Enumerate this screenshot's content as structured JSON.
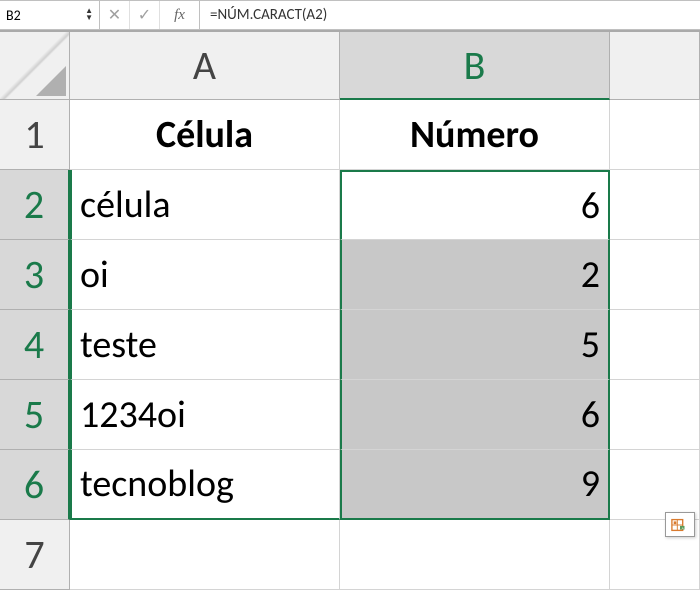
{
  "name_box": "B2",
  "formula": "=NÚM.CARACT(A2)",
  "columns": [
    "A",
    "B"
  ],
  "row_numbers": [
    "1",
    "2",
    "3",
    "4",
    "5",
    "6",
    "7"
  ],
  "headers": {
    "A": "Célula",
    "B": "Número"
  },
  "rows": [
    {
      "a": "célula",
      "b": "6"
    },
    {
      "a": "oi",
      "b": "2"
    },
    {
      "a": "teste",
      "b": "5"
    },
    {
      "a": "1234oi",
      "b": "6"
    },
    {
      "a": "tecnoblog",
      "b": "9"
    }
  ],
  "chart_data": {
    "type": "table",
    "title": "",
    "columns": [
      "Célula",
      "Número"
    ],
    "data": [
      [
        "célula",
        6
      ],
      [
        "oi",
        2
      ],
      [
        "teste",
        5
      ],
      [
        "1234oi",
        6
      ],
      [
        "tecnoblog",
        9
      ]
    ]
  }
}
